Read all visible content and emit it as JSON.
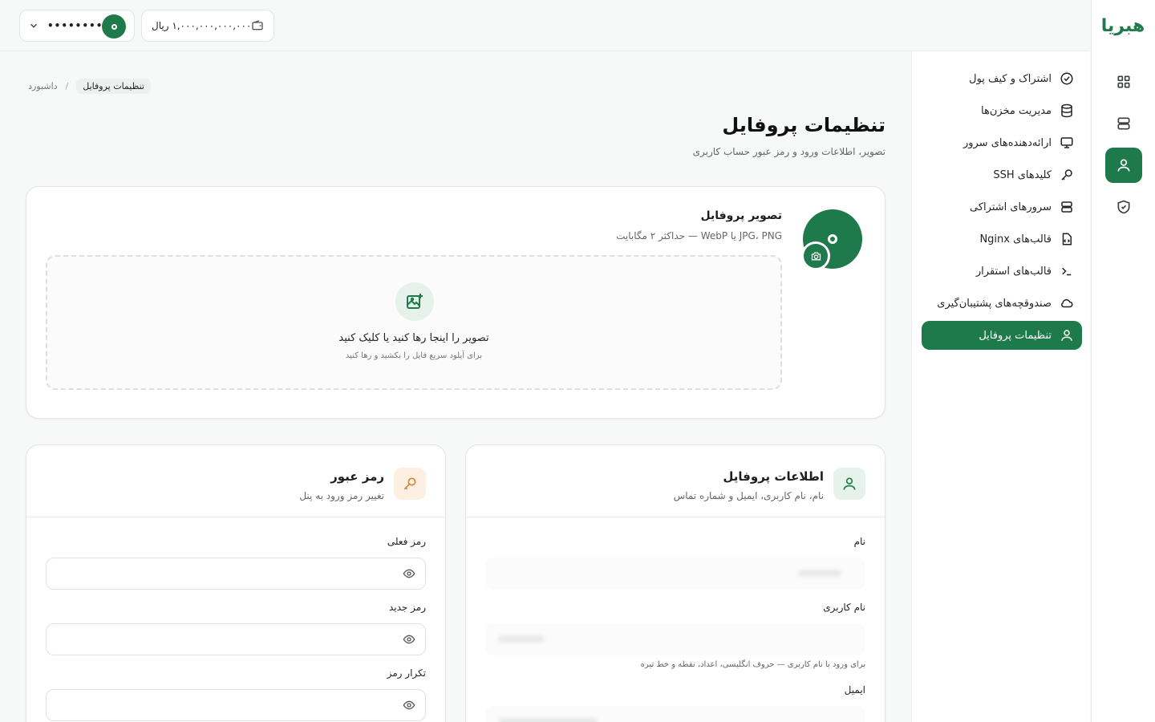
{
  "brand": {
    "logo_text": "هبریا",
    "accent": "#1e7a4a"
  },
  "topbar": {
    "user_masked": "•••••••••",
    "avatar_icon": "user-avatar-icon",
    "wallet_amount": "۱,۰۰۰,۰۰۰,۰۰۰,۰۰۰ ریال",
    "wallet_icon": "wallet-icon"
  },
  "rail": {
    "items": [
      {
        "icon": "grid-icon",
        "active": false
      },
      {
        "icon": "server-icon",
        "active": false
      },
      {
        "icon": "user-icon",
        "active": true
      },
      {
        "icon": "shield-icon",
        "active": false
      }
    ]
  },
  "sidenav": {
    "items": [
      {
        "label": "اشتراک و کیف پول",
        "icon": "check-circle-icon"
      },
      {
        "label": "مدیریت مخزن‌ها",
        "icon": "database-icon"
      },
      {
        "label": "ارائه‌دهنده‌های سرور",
        "icon": "monitor-icon"
      },
      {
        "label": "کلیدهای SSH",
        "icon": "key-icon"
      },
      {
        "label": "سرورهای اشتراکی",
        "icon": "server-icon"
      },
      {
        "label": "قالب‌های Nginx",
        "icon": "file-code-icon"
      },
      {
        "label": "قالب‌های استقرار",
        "icon": "terminal-icon"
      },
      {
        "label": "صندوقچه‌های پشتیبان‌گیری",
        "icon": "cloud-icon"
      },
      {
        "label": "تنظیمات پروفایل",
        "icon": "user-icon",
        "active": true
      }
    ]
  },
  "breadcrumb": {
    "current": "تنظیمات پروفایل",
    "separator": "/",
    "root": "داشبورد"
  },
  "page": {
    "title": "تنظیمات پروفایل",
    "subtitle": "تصویر، اطلاعات ورود و رمز عبور حساب کاربری"
  },
  "photo_card": {
    "title": "تصویر پروفایل",
    "subtitle": "JPG، PNG یا WebP — حداکثر ۲ مگابایت",
    "dropzone_title": "تصویر را اینجا رها کنید یا کلیک کنید",
    "dropzone_sub": "برای آپلود سریع فایل را بکشید و رها کنید"
  },
  "password_card": {
    "title": "رمز عبور",
    "subtitle": "تغییر رمز ورود به پنل",
    "current_label": "رمز فعلی",
    "new_label": "رمز جدید",
    "confirm_label": "تکرار رمز"
  },
  "info_card": {
    "title": "اطلاعات پروفایل",
    "subtitle": "نام، نام کاربری، ایمیل و شماره تماس",
    "name_label": "نام",
    "username_label": "نام کاربری",
    "username_hint": "برای ورود با نام کاربری — حروف انگلیسی، اعداد، نقطه و خط تیره",
    "email_label": "ایمیل"
  }
}
